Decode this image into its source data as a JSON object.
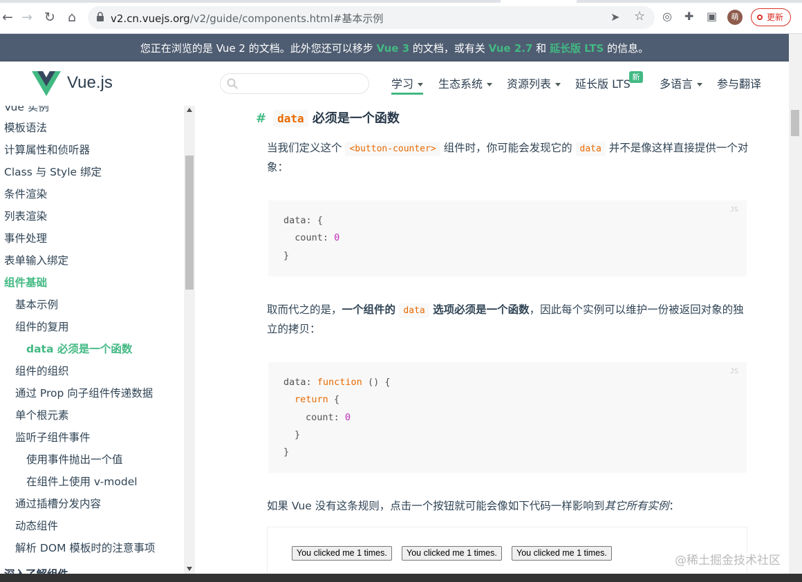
{
  "browser": {
    "url_host": "v2.cn.vuejs.org",
    "url_path": "/v2/guide/components.html#基本示例",
    "profile_initial": "萌",
    "update_label": "更新"
  },
  "banner": {
    "text_a": "您正在浏览的是 Vue 2 的文档。此外您还可以移步 ",
    "link_vue3": "Vue 3",
    "text_b": " 的文档，或有关 ",
    "link_vue27": "Vue 2.7",
    "text_c": " 和 ",
    "link_lts": "延长版 LTS",
    "text_d": " 的信息。"
  },
  "header": {
    "brand": "Vue.js",
    "search_placeholder": "",
    "menu": [
      "学习",
      "生态系统",
      "资源列表",
      "延长版 LTS",
      "多语言",
      "参与翻译"
    ],
    "new_badge": "新"
  },
  "sidebar": {
    "items": [
      "Vue 实例",
      "模板语法",
      "计算属性和侦听器",
      "Class 与 Style 绑定",
      "条件渲染",
      "列表渲染",
      "事件处理",
      "表单输入绑定",
      "组件基础",
      "基本示例",
      "组件的复用",
      "data 必须是一个函数",
      "组件的组织",
      "通过 Prop 向子组件传递数据",
      "单个根元素",
      "监听子组件事件",
      "使用事件抛出一个值",
      "在组件上使用 v-model",
      "通过插槽分发内容",
      "动态组件",
      "解析 DOM 模板时的注意事项",
      "深入了解组件"
    ]
  },
  "content": {
    "heading_hash": "#",
    "heading_code": "data",
    "heading_text": "必须是一个函数",
    "p1_a": "当我们定义这个 ",
    "p1_code1": "<button-counter>",
    "p1_b": " 组件时，你可能会发现它的 ",
    "p1_code2": "data",
    "p1_c": " 并不是像这样直接提供一个对象：",
    "code_lang": "JS",
    "code1": [
      "data: {",
      "  count: ",
      "}"
    ],
    "code1_num": "0",
    "p2_a": "取而代之的是，",
    "p2_b1": "一个组件的 ",
    "p2_code": "data",
    "p2_b2": " 选项必须是一个函数",
    "p2_c": "，因此每个实例可以维护一份被返回对象的独立的拷贝：",
    "code2_l1a": "data: ",
    "code2_l1kw": "function",
    "code2_l1b": " () {",
    "code2_l2kw": "return",
    "code2_l2b": " {",
    "code2_l3": "count: ",
    "code2_l3num": "0",
    "code2_l4": "}",
    "code2_l5": "}",
    "p3_a": "如果 Vue 没有这条规则，点击一个按钮就可能会像如下代码一样影响到",
    "p3_em": "其它所有实例",
    "p3_b": "：",
    "demo_buttons": [
      "You clicked me 1 times.",
      "You clicked me 1 times.",
      "You clicked me 1 times."
    ]
  },
  "watermark": "@稀土掘金技术社区",
  "colors": {
    "accent": "#42b983",
    "banner": "#4f5d72",
    "code_orange": "#e96900",
    "code_number": "#ae81ff"
  }
}
